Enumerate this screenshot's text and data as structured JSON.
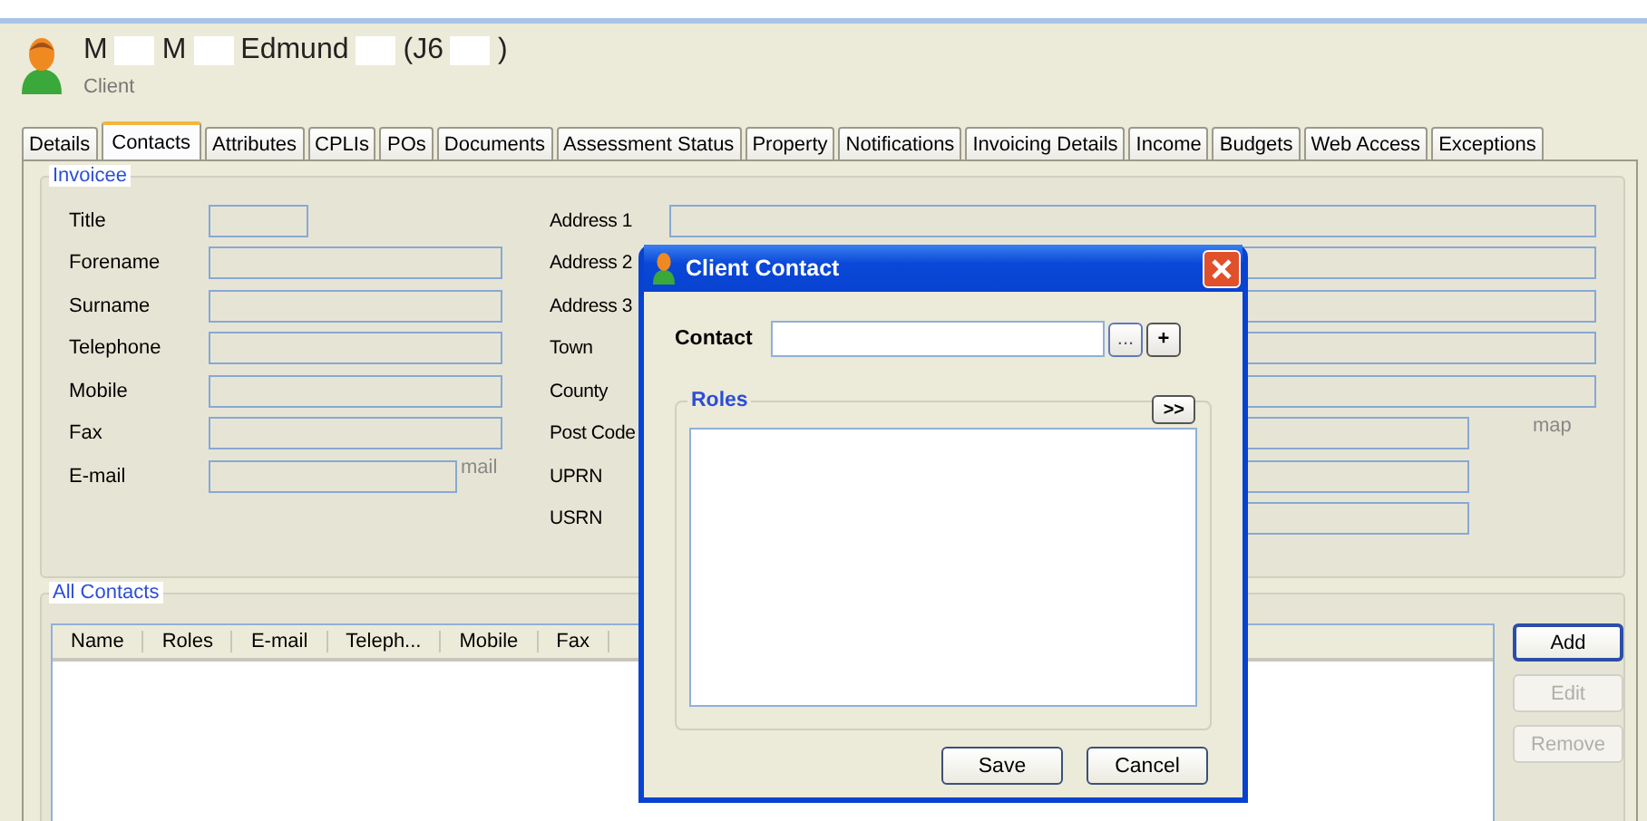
{
  "client": {
    "name_parts": [
      "M",
      "M",
      "Edmund",
      "(J6",
      ")"
    ],
    "role": "Client"
  },
  "tabs": [
    {
      "label": "Details",
      "selected": false
    },
    {
      "label": "Contacts",
      "selected": true
    },
    {
      "label": "Attributes",
      "selected": false
    },
    {
      "label": "CPLIs",
      "selected": false
    },
    {
      "label": "POs",
      "selected": false
    },
    {
      "label": "Documents",
      "selected": false
    },
    {
      "label": "Assessment Status",
      "selected": false
    },
    {
      "label": "Property",
      "selected": false
    },
    {
      "label": "Notifications",
      "selected": false
    },
    {
      "label": "Invoicing Details",
      "selected": false
    },
    {
      "label": "Income",
      "selected": false
    },
    {
      "label": "Budgets",
      "selected": false
    },
    {
      "label": "Web Access",
      "selected": false
    },
    {
      "label": "Exceptions",
      "selected": false
    }
  ],
  "invoicee": {
    "title": "Invoicee",
    "fields": [
      {
        "label": "Title",
        "kind": "short"
      },
      {
        "label": "Forename",
        "kind": "text"
      },
      {
        "label": "Surname",
        "kind": "text"
      },
      {
        "label": "Telephone",
        "kind": "text"
      },
      {
        "label": "Mobile",
        "kind": "text"
      },
      {
        "label": "Fax",
        "kind": "text"
      },
      {
        "label": "E-mail",
        "kind": "email",
        "link": "mail"
      }
    ],
    "address_fields": [
      {
        "label": "Address 1",
        "kind": "long"
      },
      {
        "label": "Address 2",
        "kind": "long"
      },
      {
        "label": "Address 3",
        "kind": "long"
      },
      {
        "label": "Town",
        "kind": "long"
      },
      {
        "label": "County",
        "kind": "long"
      },
      {
        "label": "Post Code",
        "kind": "medium",
        "link": "map"
      },
      {
        "label": "UPRN",
        "kind": "medium"
      },
      {
        "label": "USRN",
        "kind": "medium"
      }
    ]
  },
  "all_contacts": {
    "title": "All Contacts",
    "columns": [
      "Name",
      "Roles",
      "E-mail",
      "Teleph...",
      "Mobile",
      "Fax"
    ],
    "buttons": [
      {
        "label": "Add",
        "disabled": false
      },
      {
        "label": "Edit",
        "disabled": true
      },
      {
        "label": "Remove",
        "disabled": true
      }
    ]
  },
  "dialog": {
    "title": "Client Contact",
    "contact_label": "Contact",
    "browse_button": "...",
    "add_button": "+",
    "roles_title": "Roles",
    "expand_button": ">>",
    "buttons": [
      "Save",
      "Cancel"
    ]
  }
}
